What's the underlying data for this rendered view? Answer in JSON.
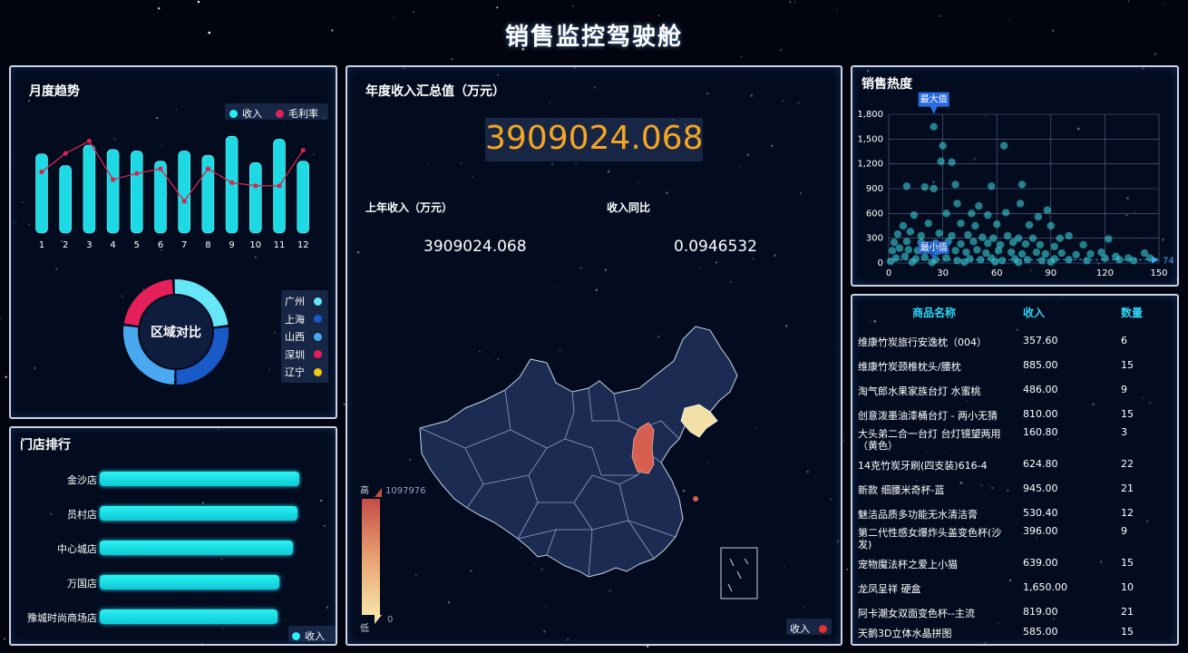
{
  "dashboard_title": "销售监控驾驶舱",
  "monthly": {
    "title": "月度趋势",
    "legend": [
      {
        "label": "收入",
        "color": "#2af0f2"
      },
      {
        "label": "毛利率",
        "color": "#e0215a"
      }
    ],
    "chart_data": {
      "type": "bar",
      "categories": [
        "1",
        "2",
        "3",
        "4",
        "5",
        "6",
        "7",
        "8",
        "9",
        "10",
        "11",
        "12"
      ],
      "series": [
        {
          "name": "收入",
          "values": [
            270,
            230,
            300,
            285,
            280,
            245,
            280,
            265,
            330,
            240,
            320,
            245
          ]
        },
        {
          "name": "毛利率",
          "values": [
            0.35,
            0.47,
            0.55,
            0.3,
            0.34,
            0.37,
            0.16,
            0.37,
            0.28,
            0.26,
            0.26,
            0.49
          ]
        }
      ]
    }
  },
  "region": {
    "center_label": "区域对比",
    "legend": [
      {
        "label": "广州",
        "color": "#66e6f6"
      },
      {
        "label": "上海",
        "color": "#1a59c8"
      },
      {
        "label": "山西",
        "color": "#4aa8f0"
      },
      {
        "label": "深圳",
        "color": "#e5205a"
      },
      {
        "label": "辽宁",
        "color": "#f2c81a"
      }
    ],
    "chart_data": {
      "type": "pie",
      "categories": [
        "广州",
        "上海",
        "山西",
        "深圳",
        "辽宁"
      ],
      "values": [
        24,
        27,
        27,
        22,
        0
      ]
    }
  },
  "stores": {
    "title": "门店排行",
    "legend_label": "收入",
    "chart_data": {
      "type": "bar",
      "categories": [
        "金沙店",
        "员村店",
        "中心城店",
        "万国店",
        "豫城时尚商场店"
      ],
      "values": [
        100,
        99,
        97,
        90,
        89
      ]
    }
  },
  "annual": {
    "title": "年度收入汇总值（万元）",
    "total": "3909024.068",
    "last_year_label": "上年收入（万元）",
    "last_year_value": "3909024.068",
    "yoy_label": "收入同比",
    "yoy_value": "0.0946532",
    "map_scale_high": "高",
    "map_scale_low": "低",
    "map_scale_max": "1097976",
    "map_scale_min": "0",
    "map_legend_label": "收入",
    "colors": {
      "shanxi": "#d65f4f",
      "liaoning": "#f3e0a6",
      "land": "#1c2b52",
      "border": "#c9d3e4"
    }
  },
  "heat": {
    "title": "销售热度",
    "max_label": "最大值",
    "min_label": "最小值",
    "avg_value": "74",
    "chart_data": {
      "type": "scatter",
      "xlim": [
        0,
        150
      ],
      "ylim": [
        0,
        1800
      ],
      "xticks": [
        "0",
        "30",
        "60",
        "90",
        "120",
        "150"
      ],
      "yticks": [
        "0",
        "300",
        "600",
        "900",
        "1,200",
        "1,500",
        "1,800"
      ],
      "points": [
        [
          25,
          1650
        ],
        [
          30,
          1420
        ],
        [
          64,
          1420
        ],
        [
          35,
          1220
        ],
        [
          29,
          1230
        ],
        [
          10,
          930
        ],
        [
          20,
          920
        ],
        [
          25,
          900
        ],
        [
          37,
          950
        ],
        [
          57,
          930
        ],
        [
          74,
          950
        ],
        [
          38,
          720
        ],
        [
          50,
          690
        ],
        [
          73,
          720
        ],
        [
          88,
          640
        ],
        [
          65,
          610
        ],
        [
          83,
          560
        ],
        [
          14,
          580
        ],
        [
          32,
          600
        ],
        [
          46,
          600
        ],
        [
          55,
          580
        ],
        [
          8,
          450
        ],
        [
          22,
          480
        ],
        [
          40,
          480
        ],
        [
          48,
          450
        ],
        [
          60,
          470
        ],
        [
          78,
          460
        ],
        [
          90,
          450
        ],
        [
          5,
          350
        ],
        [
          12,
          380
        ],
        [
          18,
          330
        ],
        [
          28,
          360
        ],
        [
          35,
          330
        ],
        [
          44,
          340
        ],
        [
          52,
          310
        ],
        [
          58,
          300
        ],
        [
          66,
          330
        ],
        [
          72,
          300
        ],
        [
          80,
          300
        ],
        [
          95,
          300
        ],
        [
          100,
          330
        ],
        [
          122,
          290
        ],
        [
          3,
          250
        ],
        [
          10,
          260
        ],
        [
          18,
          250
        ],
        [
          26,
          240
        ],
        [
          33,
          260
        ],
        [
          40,
          230
        ],
        [
          47,
          260
        ],
        [
          55,
          240
        ],
        [
          62,
          220
        ],
        [
          69,
          250
        ],
        [
          76,
          230
        ],
        [
          84,
          220
        ],
        [
          92,
          200
        ],
        [
          108,
          220
        ],
        [
          2,
          150
        ],
        [
          6,
          180
        ],
        [
          11,
          160
        ],
        [
          16,
          150
        ],
        [
          21,
          170
        ],
        [
          27,
          140
        ],
        [
          31,
          160
        ],
        [
          37,
          150
        ],
        [
          43,
          130
        ],
        [
          49,
          160
        ],
        [
          54,
          120
        ],
        [
          61,
          150
        ],
        [
          68,
          130
        ],
        [
          74,
          110
        ],
        [
          82,
          130
        ],
        [
          87,
          110
        ],
        [
          96,
          120
        ],
        [
          104,
          100
        ],
        [
          112,
          110
        ],
        [
          118,
          130
        ],
        [
          126,
          80
        ],
        [
          133,
          60
        ],
        [
          142,
          120
        ],
        [
          4,
          60
        ],
        [
          9,
          80
        ],
        [
          15,
          50
        ],
        [
          20,
          70
        ],
        [
          26,
          40
        ],
        [
          32,
          60
        ],
        [
          38,
          30
        ],
        [
          45,
          50
        ],
        [
          51,
          40
        ],
        [
          57,
          60
        ],
        [
          63,
          30
        ],
        [
          70,
          50
        ],
        [
          77,
          40
        ],
        [
          85,
          30
        ],
        [
          92,
          50
        ],
        [
          100,
          40
        ],
        [
          110,
          30
        ],
        [
          120,
          60
        ],
        [
          128,
          40
        ],
        [
          136,
          30
        ],
        [
          145,
          60
        ],
        [
          1,
          20
        ],
        [
          13,
          10
        ],
        [
          24,
          5
        ],
        [
          42,
          10
        ],
        [
          59,
          15
        ],
        [
          72,
          8
        ],
        [
          90,
          12
        ]
      ]
    }
  },
  "products": {
    "headers": {
      "name": "商品名称",
      "revenue": "收入",
      "qty": "数量"
    },
    "rows": [
      {
        "name": "维康竹炭旅行安逸枕（004）",
        "revenue": "357.60",
        "qty": "6"
      },
      {
        "name": "维康竹炭颈椎枕头/腰枕",
        "revenue": "885.00",
        "qty": "15"
      },
      {
        "name": "淘气郎水果家族台灯 水蜜桃",
        "revenue": "486.00",
        "qty": "9"
      },
      {
        "name": "创意泼墨油漆桶台灯 - 两小无猜",
        "revenue": "810.00",
        "qty": "15"
      },
      {
        "name": "大头弟二合一台灯 台灯镜望两用（黄色）",
        "revenue": "160.80",
        "qty": "3"
      },
      {
        "name": "14克竹炭牙刷(四支装)616-4",
        "revenue": "624.80",
        "qty": "22"
      },
      {
        "name": "新款 细腰米奇杯-蓝",
        "revenue": "945.00",
        "qty": "21"
      },
      {
        "name": "魅洁品质多功能无水清洁膏",
        "revenue": "530.40",
        "qty": "12"
      },
      {
        "name": "第二代性感女爆炸头盖变色杯(沙发)",
        "revenue": "396.00",
        "qty": "9"
      },
      {
        "name": "宠物魔法杯之爱上小猫",
        "revenue": "639.00",
        "qty": "15"
      },
      {
        "name": "龙凤呈祥 硬盒",
        "revenue": "1,650.00",
        "qty": "10"
      },
      {
        "name": "阿卡潮女双面变色杯--主流",
        "revenue": "819.00",
        "qty": "21"
      },
      {
        "name": "天鹅3D立体水晶拼图",
        "revenue": "585.00",
        "qty": "15"
      }
    ]
  }
}
